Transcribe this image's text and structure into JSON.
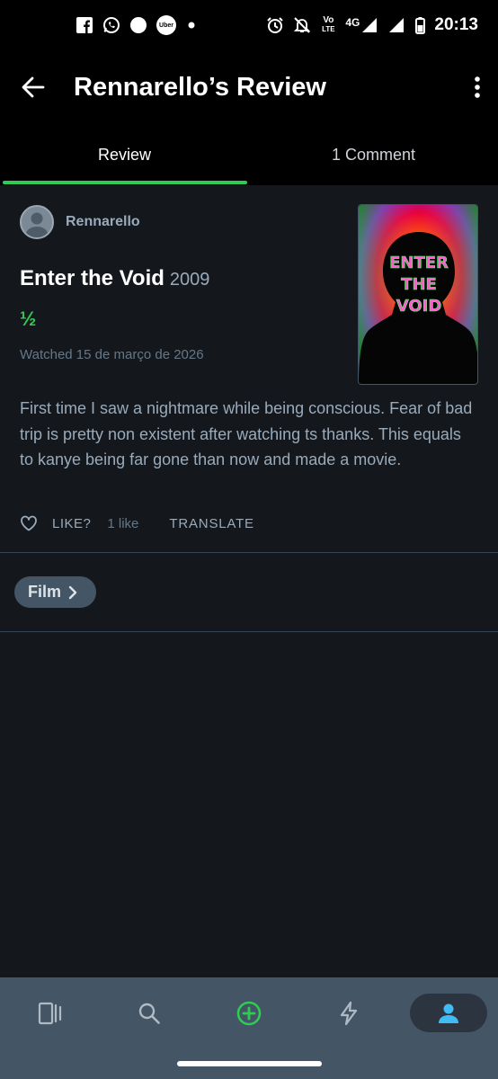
{
  "status_bar": {
    "time": "20:13",
    "network": "4G",
    "volte_top": "Vo",
    "volte_bottom": "LTE",
    "uber_label": "Uber",
    "icons": [
      "facebook-icon",
      "whatsapp-icon",
      "circle-icon",
      "uber-icon",
      "dot-icon",
      "alarm-icon",
      "mute-icon",
      "volte-icon",
      "signal-icon",
      "signal-icon",
      "battery-icon"
    ]
  },
  "app_bar": {
    "title": "Rennarello’s Review"
  },
  "tabs": [
    {
      "label": "Review",
      "active": true
    },
    {
      "label": "1 Comment",
      "active": false
    }
  ],
  "review": {
    "author": "Rennarello",
    "film_title": "Enter the Void",
    "film_year": "2009",
    "rating": "½",
    "watched": "Watched 15 de março de 2026",
    "poster_text": [
      "ENTER",
      "THE",
      "VOID"
    ],
    "text": "First time I saw a nightmare while being conscious. Fear of bad trip is pretty non existent after watching ts thanks. This equals to kanye being far gone than now and made a movie.",
    "like_label": "LIKE?",
    "like_count": "1 like",
    "translate_label": "TRANSLATE"
  },
  "chip": {
    "label": "Film"
  },
  "bottom_nav": {
    "items": [
      "films-icon",
      "search-icon",
      "add-icon",
      "activity-icon",
      "profile-icon"
    ],
    "active": "profile-icon"
  },
  "colors": {
    "accent_green": "#2ecc52",
    "accent_blue": "#40bcf4",
    "background": "#14181c",
    "nav_background": "#445566"
  }
}
